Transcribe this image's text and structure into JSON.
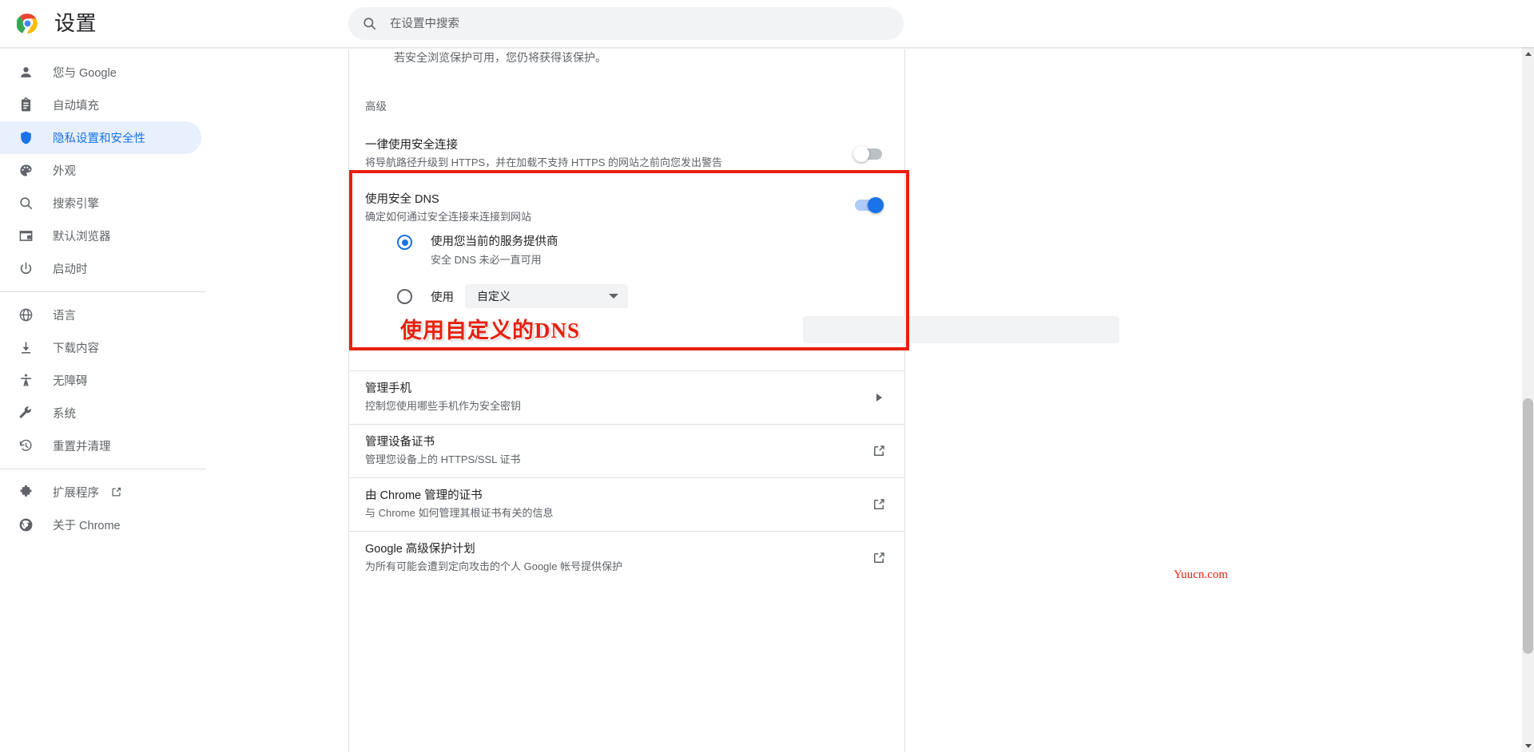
{
  "header": {
    "title": "设置",
    "logo_icon": "chrome-logo",
    "search": {
      "placeholder": "在设置中搜索",
      "value": "",
      "icon": "search-icon"
    }
  },
  "sidebar": {
    "groups": [
      {
        "items": [
          {
            "label": "您与 Google",
            "icon": "person-icon",
            "active": false
          },
          {
            "label": "自动填充",
            "icon": "clipboard-icon",
            "active": false
          },
          {
            "label": "隐私设置和安全性",
            "icon": "shield-icon",
            "active": true
          },
          {
            "label": "外观",
            "icon": "palette-icon",
            "active": false
          },
          {
            "label": "搜索引擎",
            "icon": "search-icon",
            "active": false
          },
          {
            "label": "默认浏览器",
            "icon": "browser-window-icon",
            "active": false
          },
          {
            "label": "启动时",
            "icon": "power-icon",
            "active": false
          }
        ]
      },
      {
        "items": [
          {
            "label": "语言",
            "icon": "globe-icon",
            "active": false
          },
          {
            "label": "下载内容",
            "icon": "download-icon",
            "active": false
          },
          {
            "label": "无障碍",
            "icon": "accessibility-icon",
            "active": false
          },
          {
            "label": "系统",
            "icon": "wrench-icon",
            "active": false
          },
          {
            "label": "重置并清理",
            "icon": "history-restore-icon",
            "active": false
          }
        ]
      },
      {
        "items": [
          {
            "label": "扩展程序",
            "icon": "puzzle-icon",
            "active": false,
            "external": true,
            "external_icon": "external-link-icon"
          },
          {
            "label": "关于 Chrome",
            "icon": "chrome-outline-icon",
            "active": false
          }
        ]
      }
    ]
  },
  "main": {
    "partial_text": "若安全浏览保护可用，您仍将获得该保护。",
    "section_label": "高级",
    "https_row": {
      "title": "一律使用安全连接",
      "subtitle": "将导航路径升级到 HTTPS，并在加载不支持 HTTPS 的网站之前向您发出警告",
      "toggle_state": "off"
    },
    "dns": {
      "title": "使用安全 DNS",
      "subtitle": "确定如何通过安全连接来连接到网站",
      "toggle_state": "on",
      "options": [
        {
          "label": "使用您当前的服务提供商",
          "sublabel": "安全 DNS 未必一直可用",
          "selected": true
        },
        {
          "prefix": "使用",
          "selected": false,
          "select_value": "自定义",
          "select_options": [
            "自定义"
          ],
          "custom_input_value": "",
          "custom_input_placeholder": ""
        }
      ]
    },
    "list_rows": [
      {
        "title": "管理手机",
        "subtitle": "控制您使用哪些手机作为安全密钥",
        "action_icon": "arrow-right-icon"
      },
      {
        "title": "管理设备证书",
        "subtitle": "管理您设备上的 HTTPS/SSL 证书",
        "action_icon": "external-link-icon"
      },
      {
        "title": "由 Chrome 管理的证书",
        "subtitle": "与 Chrome 如何管理其根证书有关的信息",
        "action_icon": "external-link-icon"
      },
      {
        "title": "Google 高级保护计划",
        "subtitle": "为所有可能会遭到定向攻击的个人 Google 帐号提供保护",
        "action_icon": "external-link-icon"
      }
    ]
  },
  "annotation": {
    "text": "使用自定义的DNS",
    "color": "#e8200f"
  },
  "watermark": {
    "text": "Yuucn.com"
  },
  "colors": {
    "accent": "#1a73e8",
    "active_bg": "#e8f0fe",
    "text_primary": "#202124",
    "text_secondary": "#5f6368",
    "annotation_red": "#e8200f"
  }
}
